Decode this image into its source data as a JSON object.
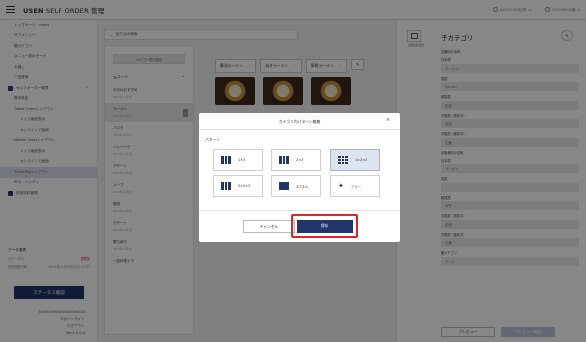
{
  "header": {
    "title_bold": "USEN",
    "title_rest": " SELF ORDER 管理",
    "account": "AASOOUSEN企業",
    "store": "0001USEN店舗"
  },
  "sidebar": {
    "items": [
      {
        "label": "トップページ - menu"
      },
      {
        "label": "サブメニュー"
      },
      {
        "label": "親カテゴリ"
      },
      {
        "label": "メニュー表示モード"
      },
      {
        "label": "お通し"
      },
      {
        "label": "一括登録"
      },
      {
        "label": "セルフオーダー管理"
      },
      {
        "label": "基本設定"
      },
      {
        "label": "Tablet Orderレイアウト"
      },
      {
        "label": "トップ画面表示"
      },
      {
        "label": "オンラインで画面"
      },
      {
        "label": "Mobile Orderレイアウト"
      },
      {
        "label": "トップ画面表示"
      },
      {
        "label": "オンラインで画面"
      },
      {
        "label": "TicketPayレイアウト"
      },
      {
        "label": "POS・ハンディ"
      },
      {
        "label": "説明資料管理"
      }
    ],
    "data_section": {
      "label": "データ連携",
      "row1_left": "ステータス",
      "row1_right": "連携前",
      "row2_left": "前回連携日時",
      "row2_right": "2023年11月02日(木) 17:37"
    },
    "status_button": "ステータス確認",
    "footer": {
      "user": "U0001000000000000034",
      "support": "サポートサイト",
      "logout": "ログアウト",
      "version": "Ver.2.0.0.0"
    }
  },
  "main": {
    "filter_label": "絞り込み検索",
    "settings_button": "カテゴリ表示設定",
    "code_label": "コード",
    "categories": [
      {
        "name": "今日のおすすめ",
        "date": "2023年11月1日"
      },
      {
        "name": "ラーメン",
        "date": "2023年11月1日"
      },
      {
        "name": "パスタ",
        "date": "2023年11月1日"
      },
      {
        "name": "ハンバーグ",
        "date": "2023年11月1日"
      },
      {
        "name": "デザート",
        "date": "2023年11月1日"
      },
      {
        "name": "ルーブ",
        "date": "2023年11月1日"
      },
      {
        "name": "揚物",
        "date": "2023年11月1日"
      },
      {
        "name": "デザート",
        "date": "2023年11月1日"
      },
      {
        "name": "煮ち燻り",
        "date": "2023年11月1日"
      },
      {
        "name": "一品料理ナウ",
        "date": ""
      }
    ],
    "chips": [
      {
        "label": "醤油ラーメン",
        "kebab": "⋮"
      },
      {
        "label": "ねぎラーメン",
        "kebab": "⋮"
      },
      {
        "label": "豚骨ラーメン",
        "kebab": "⋮"
      }
    ]
  },
  "right_panel": {
    "icon_label": "画面内容切替",
    "title": "子カテゴリ",
    "fields": [
      {
        "label": "店舗向け名称",
        "value": ""
      },
      {
        "label": "日本語",
        "value": "ラーメン"
      },
      {
        "label": "英語",
        "value": "Ramen"
      },
      {
        "label": "韓国語",
        "value": "拉面"
      },
      {
        "label": "中国語（簡体字）",
        "value": "拉面"
      },
      {
        "label": "中国語（繁体字）",
        "value": "拉麵"
      },
      {
        "label": "お客様向け名称",
        "value": ""
      },
      {
        "label": "日本語",
        "value": "ラーメン"
      },
      {
        "label": "英語",
        "value": ""
      },
      {
        "label": "韓国語",
        "value": "라면"
      },
      {
        "label": "中国語（簡体字）",
        "value": "拉面"
      },
      {
        "label": "中国語（繁体字）",
        "value": "拉麵"
      },
      {
        "label": "親カテゴリ",
        "value": "フード"
      }
    ],
    "preview_button": "プレビュー",
    "confirm_button": "プレビュー確認"
  },
  "modal": {
    "title": "カテゴリ内パターン編集",
    "close": "×",
    "section_label": "パターン",
    "patterns": [
      {
        "label": "1×3",
        "selected": false
      },
      {
        "label": "2×3",
        "selected": false
      },
      {
        "label": "1×2×3",
        "selected": true
      },
      {
        "label": "2×2×3",
        "selected": false
      },
      {
        "label": "3パネル",
        "selected": false
      },
      {
        "label": "フリー",
        "selected": false
      }
    ],
    "cancel": "キャンセル",
    "save": "保存"
  },
  "colors": {
    "navy": "#22356b",
    "highlight_red": "#e8202a",
    "selected_bg": "#dde3ef"
  }
}
